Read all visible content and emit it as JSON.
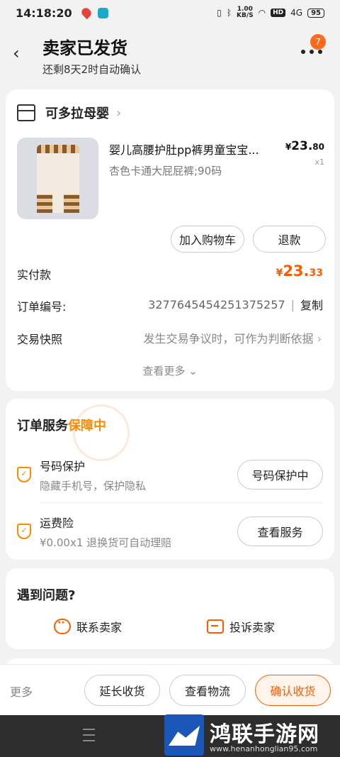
{
  "status_bar": {
    "time": "14:18:20",
    "net_speed_value": "1.00",
    "net_speed_unit": "KB/S",
    "hd": "HD",
    "signal": "4G",
    "battery": "95"
  },
  "header": {
    "title": "卖家已发货",
    "subtitle": "还剩8天2时自动确认",
    "more_badge": "7"
  },
  "order": {
    "shop_name": "可多拉母婴",
    "product": {
      "title": "婴儿高腰护肚pp裤男童宝宝...",
      "spec": "杏色卡通大屁屁裤;90码",
      "price_currency": "¥",
      "price_int": "23.",
      "price_dec": "80",
      "quantity": "x1"
    },
    "add_to_cart_label": "加入购物车",
    "refund_label": "退款",
    "paid_label": "实付款",
    "paid_currency": "¥",
    "paid_int": "23.",
    "paid_dec": "33",
    "order_no_label": "订单编号:",
    "order_no": "3277645454251375257",
    "order_sep": "|",
    "copy_label": "复制",
    "snapshot_label": "交易快照",
    "snapshot_value": "发生交易争议时，可作为判断依据",
    "see_more": "查看更多"
  },
  "service": {
    "title": "订单服务",
    "status": "保障中",
    "items": [
      {
        "name": "号码保护",
        "desc": "隐藏手机号，保护隐私",
        "button": "号码保护中"
      },
      {
        "name": "运费险",
        "desc": "¥0.00x1  退换货可自动理赔",
        "button": "查看服务"
      }
    ]
  },
  "problem": {
    "title": "遇到问题?",
    "contact_label": "联系卖家",
    "complain_label": "投诉卖家"
  },
  "bottom_bar": {
    "more_label": "更多",
    "extend_label": "延长收货",
    "logistics_label": "查看物流",
    "confirm_label": "确认收货"
  },
  "watermark": {
    "title": "鸿联手游网",
    "url": "www.henanhonglian95.com"
  },
  "colors": {
    "accent": "#ff5a00",
    "guard": "#ff8a00",
    "background": "#f2f2f2"
  }
}
